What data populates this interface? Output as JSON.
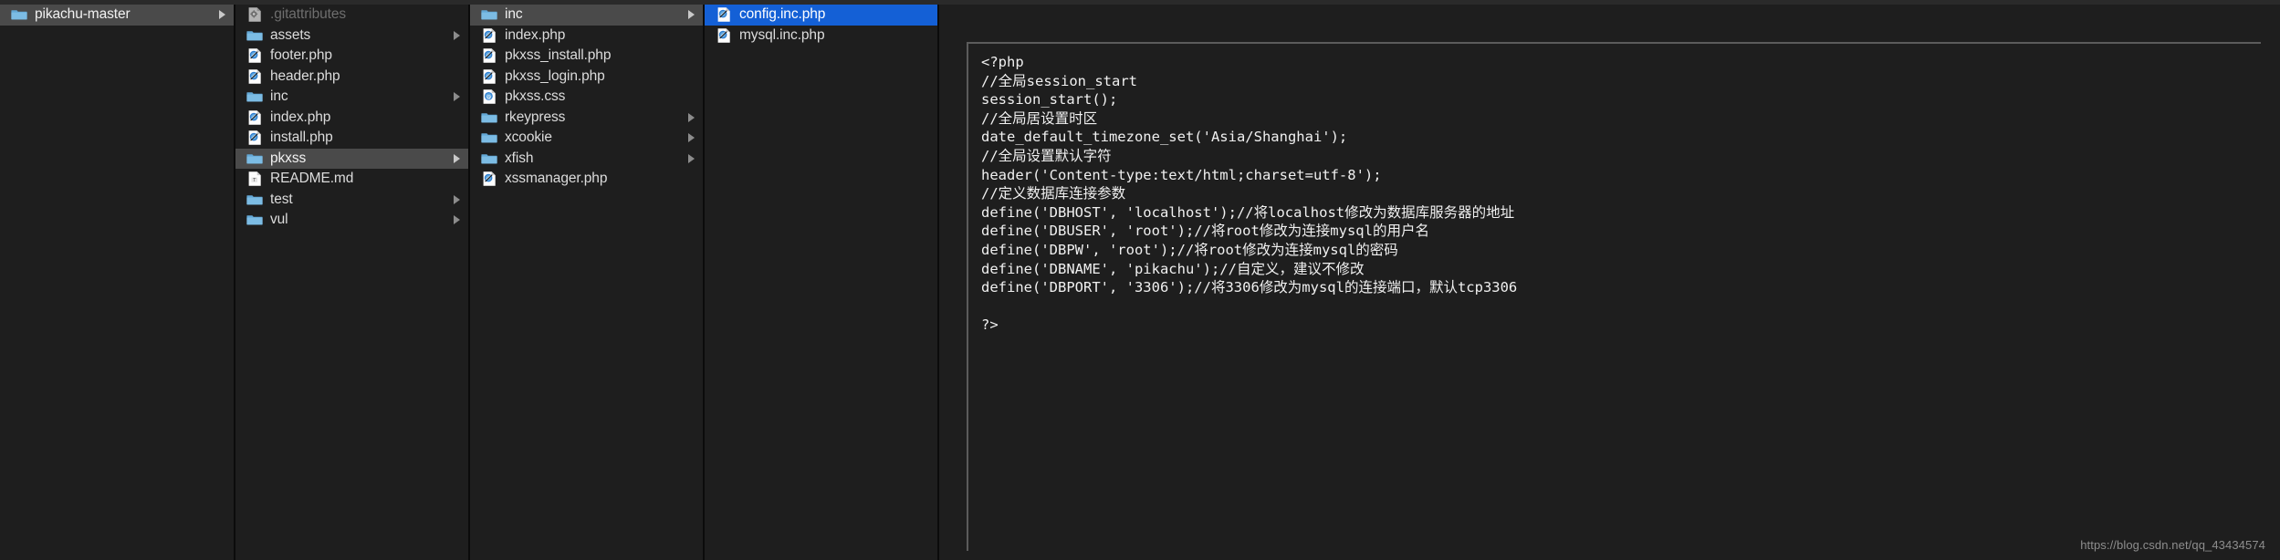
{
  "window": {
    "title": "pikachu-master",
    "view": "column-view",
    "theme_colors": {
      "background": "#1e1e1e",
      "selection_blue": "#1460d6",
      "selection_gray": "#4a4a4a",
      "divider": "#0b0b0b",
      "text": "#dcdcdc",
      "text_dim": "#6e6e6e",
      "preview_border": "#5b5b5b"
    }
  },
  "columns": [
    {
      "name": "column-root",
      "items": [
        {
          "label": "pikachu-master",
          "icon": "folder-icon",
          "kind": "folder",
          "selected": "gray",
          "chevron": true,
          "dim": false
        }
      ]
    },
    {
      "name": "column-pikachu-master",
      "items": [
        {
          "label": ".gitattributes",
          "icon": "gear-file-icon",
          "kind": "file",
          "selected": "none",
          "chevron": false,
          "dim": true
        },
        {
          "label": "assets",
          "icon": "folder-icon",
          "kind": "folder",
          "selected": "none",
          "chevron": true,
          "dim": false
        },
        {
          "label": "footer.php",
          "icon": "php-file-icon",
          "kind": "file",
          "selected": "none",
          "chevron": false,
          "dim": false
        },
        {
          "label": "header.php",
          "icon": "php-file-icon",
          "kind": "file",
          "selected": "none",
          "chevron": false,
          "dim": false
        },
        {
          "label": "inc",
          "icon": "folder-icon",
          "kind": "folder",
          "selected": "none",
          "chevron": true,
          "dim": false
        },
        {
          "label": "index.php",
          "icon": "php-file-icon",
          "kind": "file",
          "selected": "none",
          "chevron": false,
          "dim": false
        },
        {
          "label": "install.php",
          "icon": "php-file-icon",
          "kind": "file",
          "selected": "none",
          "chevron": false,
          "dim": false
        },
        {
          "label": "pkxss",
          "icon": "folder-icon",
          "kind": "folder",
          "selected": "gray",
          "chevron": true,
          "dim": false
        },
        {
          "label": "README.md",
          "icon": "text-file-icon",
          "kind": "file",
          "selected": "none",
          "chevron": false,
          "dim": false
        },
        {
          "label": "test",
          "icon": "folder-icon",
          "kind": "folder",
          "selected": "none",
          "chevron": true,
          "dim": false
        },
        {
          "label": "vul",
          "icon": "folder-icon",
          "kind": "folder",
          "selected": "none",
          "chevron": true,
          "dim": false
        }
      ]
    },
    {
      "name": "column-pkxss",
      "items": [
        {
          "label": "inc",
          "icon": "folder-icon",
          "kind": "folder",
          "selected": "gray",
          "chevron": true,
          "dim": false
        },
        {
          "label": "index.php",
          "icon": "php-file-icon",
          "kind": "file",
          "selected": "none",
          "chevron": false,
          "dim": false
        },
        {
          "label": "pkxss_install.php",
          "icon": "php-file-icon",
          "kind": "file",
          "selected": "none",
          "chevron": false,
          "dim": false
        },
        {
          "label": "pkxss_login.php",
          "icon": "php-file-icon",
          "kind": "file",
          "selected": "none",
          "chevron": false,
          "dim": false
        },
        {
          "label": "pkxss.css",
          "icon": "css-file-icon",
          "kind": "file",
          "selected": "none",
          "chevron": false,
          "dim": false
        },
        {
          "label": "rkeypress",
          "icon": "folder-icon",
          "kind": "folder",
          "selected": "none",
          "chevron": true,
          "dim": false
        },
        {
          "label": "xcookie",
          "icon": "folder-icon",
          "kind": "folder",
          "selected": "none",
          "chevron": true,
          "dim": false
        },
        {
          "label": "xfish",
          "icon": "folder-icon",
          "kind": "folder",
          "selected": "none",
          "chevron": true,
          "dim": false
        },
        {
          "label": "xssmanager.php",
          "icon": "php-file-icon",
          "kind": "file",
          "selected": "none",
          "chevron": false,
          "dim": false
        }
      ]
    },
    {
      "name": "column-inc",
      "items": [
        {
          "label": "config.inc.php",
          "icon": "php-file-icon",
          "kind": "file",
          "selected": "blue",
          "chevron": false,
          "dim": false
        },
        {
          "label": "mysql.inc.php",
          "icon": "php-file-icon",
          "kind": "file",
          "selected": "none",
          "chevron": false,
          "dim": false
        }
      ]
    }
  ],
  "preview": {
    "name": "config.inc.php",
    "language": "php",
    "code": "<?php\n//全局session_start\nsession_start();\n//全局居设置时区\ndate_default_timezone_set('Asia/Shanghai');\n//全局设置默认字符\nheader('Content-type:text/html;charset=utf-8');\n//定义数据库连接参数\ndefine('DBHOST', 'localhost');//将localhost修改为数据库服务器的地址\ndefine('DBUSER', 'root');//将root修改为连接mysql的用户名\ndefine('DBPW', 'root');//将root修改为连接mysql的密码\ndefine('DBNAME', 'pikachu');//自定义，建议不修改\ndefine('DBPORT', '3306');//将3306修改为mysql的连接端口，默认tcp3306\n\n?>"
  },
  "watermark": {
    "text": "https://blog.csdn.net/qq_43434574"
  }
}
